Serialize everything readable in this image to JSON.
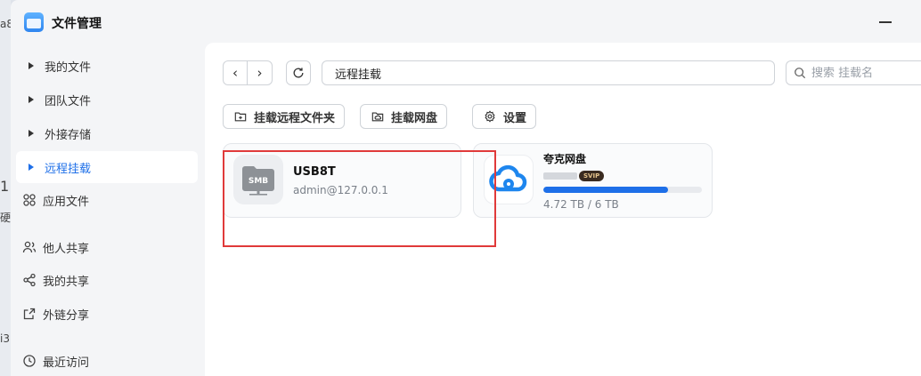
{
  "background": {
    "fragments": [
      "a8",
      "1",
      "硬",
      "i3"
    ]
  },
  "app": {
    "title": "文件管理",
    "icon": "folder-app-icon"
  },
  "sidebar": {
    "items": [
      {
        "label": "我的文件",
        "icon": "caret-right-icon",
        "active": false
      },
      {
        "label": "团队文件",
        "icon": "caret-right-icon",
        "active": false
      },
      {
        "label": "外接存储",
        "icon": "caret-right-icon",
        "active": false
      },
      {
        "label": "远程挂载",
        "icon": "caret-right-icon",
        "active": true
      },
      {
        "label": "应用文件",
        "icon": "apps-grid-icon",
        "active": false
      },
      {
        "label": "他人共享",
        "icon": "users-icon",
        "active": false
      },
      {
        "label": "我的共享",
        "icon": "share-icon",
        "active": false
      },
      {
        "label": "外链分享",
        "icon": "external-link-icon",
        "active": false
      },
      {
        "label": "最近访问",
        "icon": "clock-icon",
        "active": false
      }
    ]
  },
  "toolbar": {
    "back": "‹",
    "forward": "›",
    "path": "远程挂载",
    "search_placeholder": "搜索 挂载名"
  },
  "actions": {
    "mount_remote_folder": "挂载远程文件夹",
    "mount_cloud_drive": "挂载网盘",
    "settings": "设置"
  },
  "mounts": [
    {
      "name": "USB8T",
      "subtitle": "admin@127.0.0.1",
      "icon_label": "SMB",
      "type": "smb"
    },
    {
      "name": "夸克网盘",
      "badge": "SVIP",
      "usage": "4.72 TB / 6 TB",
      "usage_fraction": 0.787,
      "type": "cloud"
    }
  ],
  "colors": {
    "accent": "#1e6fe8",
    "highlight": "#e03a3a"
  }
}
